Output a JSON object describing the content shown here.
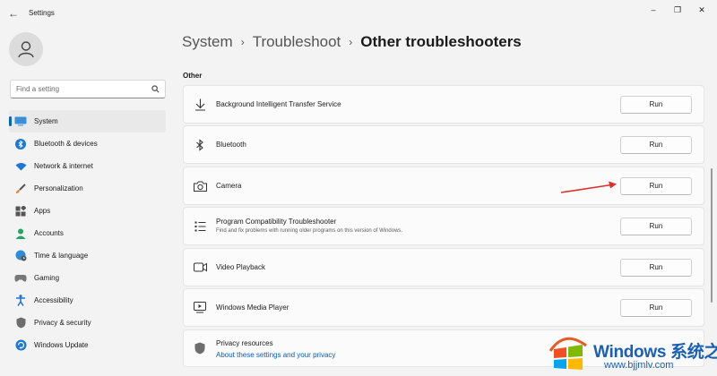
{
  "window": {
    "title": "Settings",
    "back_glyph": "←",
    "minimize_glyph": "–",
    "maximize_glyph": "❐",
    "close_glyph": "✕"
  },
  "search": {
    "placeholder": "Find a setting",
    "icon": "search-icon"
  },
  "sidebar": {
    "items": [
      {
        "label": "System",
        "icon": "system-icon",
        "active": true
      },
      {
        "label": "Bluetooth & devices",
        "icon": "bluetooth-icon"
      },
      {
        "label": "Network & internet",
        "icon": "wifi-icon"
      },
      {
        "label": "Personalization",
        "icon": "brush-icon"
      },
      {
        "label": "Apps",
        "icon": "apps-icon"
      },
      {
        "label": "Accounts",
        "icon": "person-icon"
      },
      {
        "label": "Time & language",
        "icon": "globe-clock-icon"
      },
      {
        "label": "Gaming",
        "icon": "gamepad-icon"
      },
      {
        "label": "Accessibility",
        "icon": "accessibility-icon"
      },
      {
        "label": "Privacy & security",
        "icon": "shield-icon"
      },
      {
        "label": "Windows Update",
        "icon": "update-icon"
      }
    ]
  },
  "breadcrumb": {
    "item1": "System",
    "item2": "Troubleshoot",
    "current": "Other troubleshooters",
    "separator": "›"
  },
  "section": {
    "label": "Other"
  },
  "troubleshooters": [
    {
      "title": "Background Intelligent Transfer Service",
      "subtitle": "",
      "icon": "download-icon",
      "button": "Run"
    },
    {
      "title": "Bluetooth",
      "subtitle": "",
      "icon": "bluetooth-icon",
      "button": "Run"
    },
    {
      "title": "Camera",
      "subtitle": "",
      "icon": "camera-icon",
      "button": "Run"
    },
    {
      "title": "Program Compatibility Troubleshooter",
      "subtitle": "Find and fix problems with running older programs on this version of Windows.",
      "icon": "list-icon",
      "button": "Run"
    },
    {
      "title": "Video Playback",
      "subtitle": "",
      "icon": "video-icon",
      "button": "Run"
    },
    {
      "title": "Windows Media Player",
      "subtitle": "",
      "icon": "media-player-icon",
      "button": "Run"
    }
  ],
  "privacy": {
    "title": "Privacy resources",
    "link": "About these settings and your privacy",
    "icon": "shield-icon"
  },
  "colors": {
    "accent": "#0067c0",
    "annotation_arrow": "#d9312b",
    "link": "#0a5bbf"
  },
  "watermark": {
    "text": "Windows 系统之家",
    "url": "www.bjjmlv.com"
  }
}
